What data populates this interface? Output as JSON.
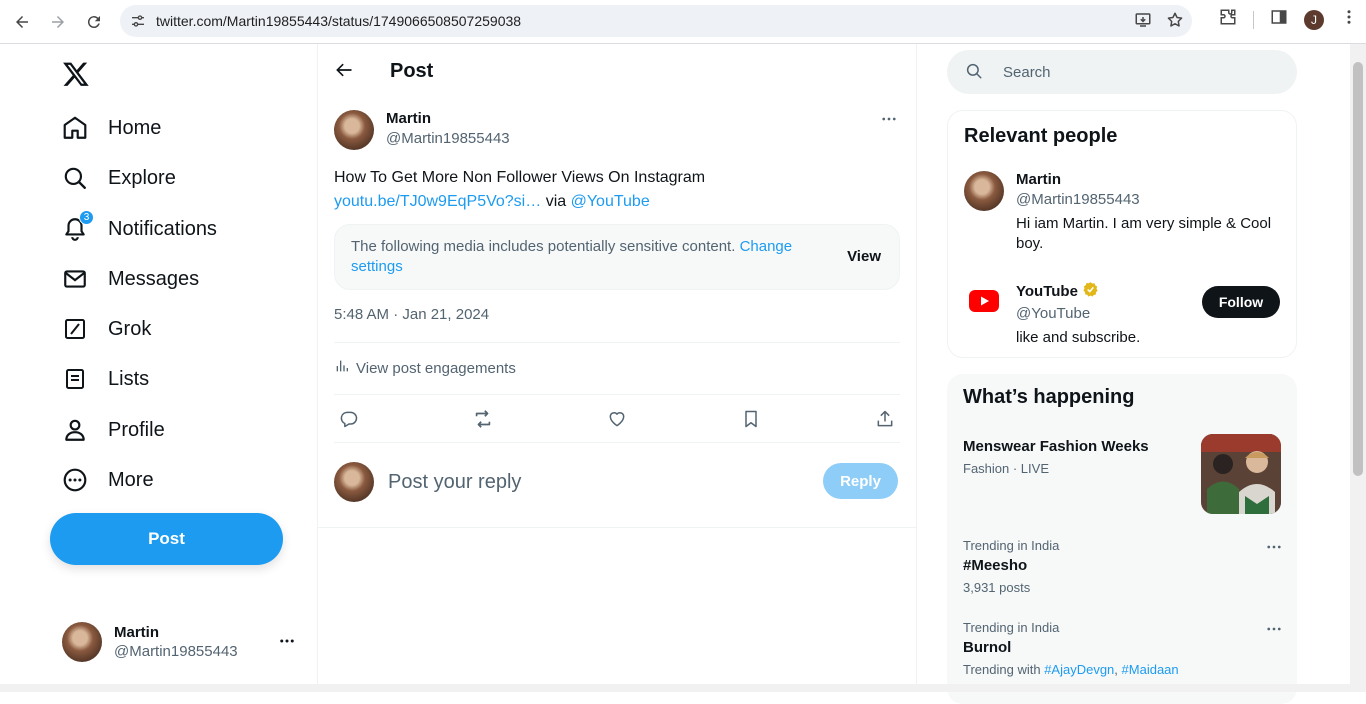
{
  "browser": {
    "url": "twitter.com/Martin19855443/status/1749066508507259038",
    "profile_initial": "J"
  },
  "nav": {
    "items": [
      {
        "label": "Home",
        "icon": "home-icon"
      },
      {
        "label": "Explore",
        "icon": "search-icon"
      },
      {
        "label": "Notifications",
        "icon": "bell-icon",
        "badge": "3"
      },
      {
        "label": "Messages",
        "icon": "mail-icon"
      },
      {
        "label": "Grok",
        "icon": "grok-icon"
      },
      {
        "label": "Lists",
        "icon": "list-icon"
      },
      {
        "label": "Profile",
        "icon": "person-icon"
      },
      {
        "label": "More",
        "icon": "more-circle-icon"
      }
    ],
    "post_button": "Post",
    "account": {
      "name": "Martin",
      "handle": "@Martin19855443"
    }
  },
  "main": {
    "title": "Post",
    "author": {
      "name": "Martin",
      "handle": "@Martin19855443"
    },
    "text": "How To Get More Non Follower Views On Instagram",
    "link": "youtu.be/TJ0w9EqP5Vo?si…",
    "via": "via",
    "mention": "@YouTube",
    "sensitive": {
      "text": "The following media includes potentially sensitive content.",
      "change_link": "Change settings",
      "view": "View"
    },
    "timestamp": "5:48 AM · Jan 21, 2024",
    "engagements": "View post engagements",
    "reply_placeholder": "Post your reply",
    "reply_button": "Reply"
  },
  "right": {
    "search_placeholder": "Search",
    "relevant": {
      "title": "Relevant people",
      "people": [
        {
          "name": "Martin",
          "handle": "@Martin19855443",
          "bio": "Hi iam Martin. I am very simple & Cool boy."
        },
        {
          "name": "YouTube",
          "handle": "@YouTube",
          "bio": "like and subscribe.",
          "follow": "Follow",
          "verified": true
        }
      ]
    },
    "happening": {
      "title": "What’s happening",
      "trends": [
        {
          "title": "Menswear Fashion Weeks",
          "meta": "Fashion · LIVE"
        },
        {
          "meta": "Trending in India",
          "title": "#Meesho",
          "sub": "3,931 posts"
        },
        {
          "meta": "Trending in India",
          "title": "Burnol",
          "sub_prefix": "Trending with",
          "tag1": "#AjayDevgn",
          "sep": ",",
          "tag2": "#Maidaan"
        }
      ]
    }
  },
  "colors": {
    "accent": "#1d9bf0",
    "text": "#0f1419",
    "muted": "#536471"
  }
}
